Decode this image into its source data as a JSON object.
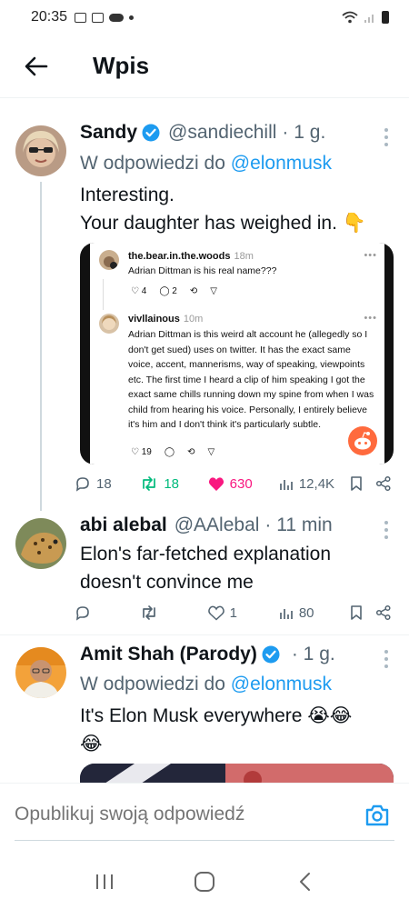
{
  "status_bar": {
    "time": "20:35"
  },
  "header": {
    "title": "Wpis"
  },
  "tweets": [
    {
      "name": "Sandy",
      "verified": true,
      "handle": "@sandiechill",
      "time": "· 1 g.",
      "reply_prefix": "W odpowiedzi do ",
      "reply_to": "@elonmusk",
      "text_line1": "Interesting.",
      "text_line2": "Your daughter has weighed in. 👇",
      "embed": {
        "comment1": {
          "user": "the.bear.in.the.woods",
          "time": "18m",
          "text": "Adrian Dittman is his real name???",
          "likes": "4",
          "replies": "2"
        },
        "comment2": {
          "user": "vivllainous",
          "time": "10m",
          "text": "Adrian Dittman is this weird alt account he (allegedly so I don't get sued) uses on twitter. It has the exact same voice, accent, mannerisms, way of speaking, viewpoints etc. The first time I heard a clip of him speaking I got the exact same chills running down my spine from when I was child from hearing his voice. Personally, I entirely believe it's him and I don't think it's particularly subtle.",
          "likes": "19"
        }
      },
      "stats": {
        "replies": "18",
        "reposts": "18",
        "likes": "630",
        "views": "12,4K"
      },
      "colors": {
        "repost": "#00ba7c",
        "like": "#f91880"
      }
    },
    {
      "name": "abi alebal",
      "handle": "@AAlebal",
      "time": "· 11 min",
      "text_line1": "Elon's far-fetched explanation",
      "text_line2": "doesn't convince me",
      "stats": {
        "replies": "",
        "reposts": "",
        "likes": "1",
        "views": "80"
      }
    },
    {
      "name": "Amit Shah (Parody)",
      "verified": true,
      "handle": "",
      "time": "· 1 g.",
      "reply_prefix": "W odpowiedzi do ",
      "reply_to": "@elonmusk",
      "text_line1": "It's Elon Musk everywhere 😭😂",
      "text_line2": "😂"
    }
  ],
  "reply_bar": {
    "placeholder": "Opublikuj swoją odpowiedź"
  },
  "colors": {
    "accent": "#1d9bf0",
    "verified": "#1d9bf0",
    "text_secondary": "#536471"
  }
}
